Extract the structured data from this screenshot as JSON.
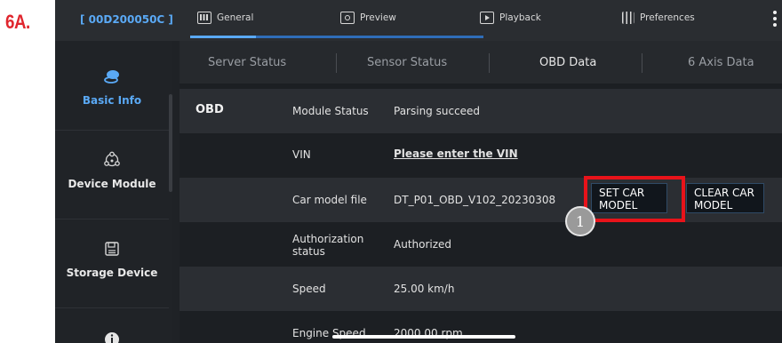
{
  "step_label": "6A.",
  "header": {
    "device_id": "[ 00D200050C ]",
    "tabs": [
      {
        "label": "General",
        "icon": "grid-icon"
      },
      {
        "label": "Preview",
        "icon": "eye-icon"
      },
      {
        "label": "Playback",
        "icon": "playback-icon"
      },
      {
        "label": "Preferences",
        "icon": "sliders-icon"
      }
    ],
    "active_tab": "General"
  },
  "sidebar": {
    "items": [
      {
        "label": "Basic Info",
        "icon": "car-icon",
        "active": true
      },
      {
        "label": "Device Module",
        "icon": "network-icon",
        "active": false
      },
      {
        "label": "Storage Device",
        "icon": "save-icon",
        "active": false
      },
      {
        "label": "",
        "icon": "info-icon",
        "active": false
      }
    ]
  },
  "subtabs": [
    {
      "label": "Server Status",
      "active": false
    },
    {
      "label": "Sensor Status",
      "active": false
    },
    {
      "label": "OBD Data",
      "active": true
    },
    {
      "label": "6 Axis Data",
      "active": false
    }
  ],
  "obd": {
    "section_title": "OBD",
    "rows": [
      {
        "key": "Module Status",
        "value": "Parsing succeed"
      },
      {
        "key": "VIN",
        "value": "Please enter the VIN"
      },
      {
        "key": "Car model file",
        "value": "DT_P01_OBD_V102_20230308"
      },
      {
        "key": "Authorization status",
        "value": "Authorized"
      },
      {
        "key": "Speed",
        "value": "25.00 km/h"
      },
      {
        "key": "Engine Speed",
        "value": "2000.00 rpm"
      }
    ],
    "set_car_model_button": "SET CAR MODEL",
    "clear_car_model_button": "CLEAR CAR MODEL"
  },
  "annotation": {
    "step_number": "1",
    "highlight_color": "#e8131a"
  },
  "colors": {
    "accent": "#5aa9f5",
    "link": "#4ea3f2",
    "background": "#1f2226",
    "step_label": "#e0262e"
  }
}
